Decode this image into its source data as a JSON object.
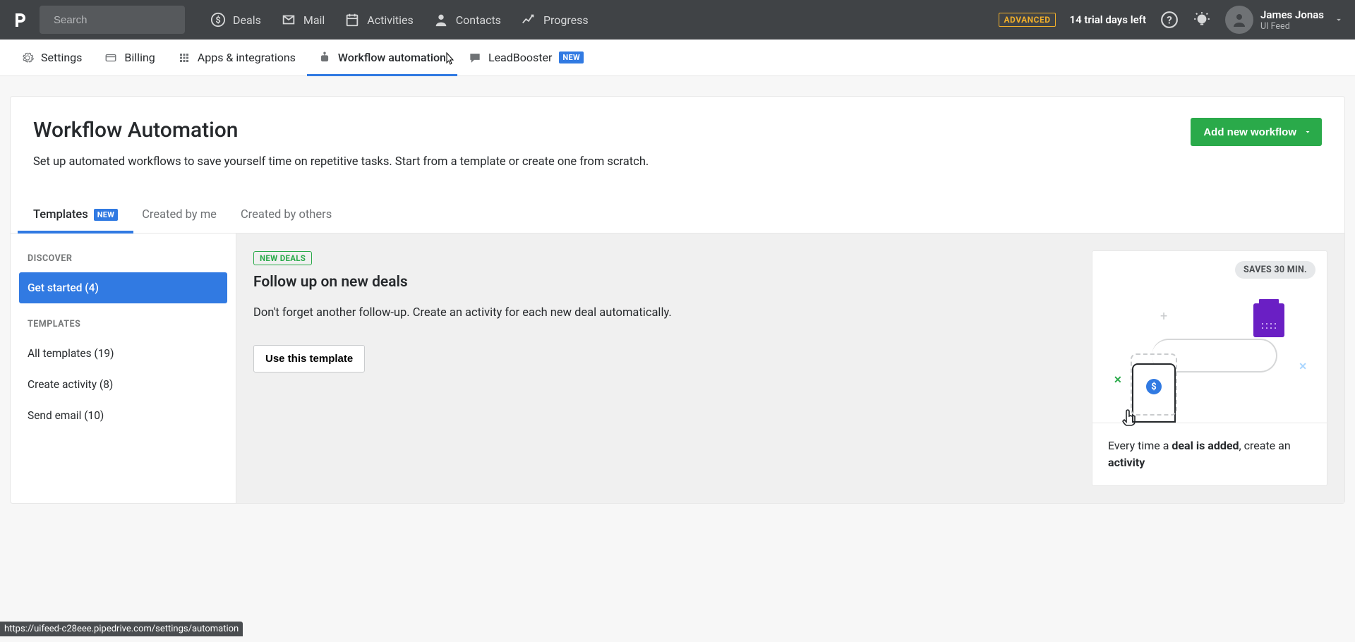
{
  "topnav": {
    "search_placeholder": "Search",
    "items": [
      "Deals",
      "Mail",
      "Activities",
      "Contacts",
      "Progress"
    ],
    "advanced_badge": "ADVANCED",
    "trial_text": "14 trial days left",
    "user_name": "James Jonas",
    "user_sub": "UI Feed"
  },
  "subnav": {
    "items": [
      "Settings",
      "Billing",
      "Apps & integrations",
      "Workflow automation",
      "LeadBooster"
    ],
    "new_badge": "NEW"
  },
  "page": {
    "title": "Workflow Automation",
    "desc": "Set up automated workflows to save yourself time on repetitive tasks. Start from a template or create one from scratch.",
    "add_btn": "Add new workflow"
  },
  "tabs": {
    "templates": "Templates",
    "templates_badge": "NEW",
    "created_me": "Created by me",
    "created_others": "Created by others"
  },
  "sidebar": {
    "discover_head": "DISCOVER",
    "get_started": "Get started (4)",
    "templates_head": "TEMPLATES",
    "all_templates": "All templates (19)",
    "create_activity": "Create activity (8)",
    "send_email": "Send email (10)"
  },
  "card": {
    "badge": "NEW DEALS",
    "title": "Follow up on new deals",
    "desc": "Don't forget another follow-up. Create an activity for each new deal automatically.",
    "use_btn": "Use this template",
    "saves": "SAVES 30 MIN.",
    "preview_prefix": "Every time a ",
    "preview_bold1": "deal is added",
    "preview_mid": ", create an ",
    "preview_bold2": "activity"
  },
  "statusbar": "https://uifeed-c28eee.pipedrive.com/settings/automation"
}
